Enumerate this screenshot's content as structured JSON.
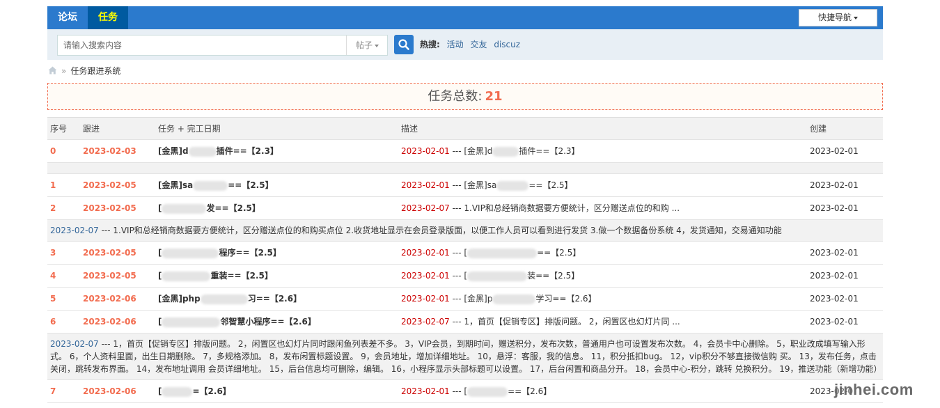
{
  "nav": {
    "forum_label": "论坛",
    "task_label": "任务",
    "quicknav_label": "快捷导航"
  },
  "search": {
    "placeholder": "请输入搜索内容",
    "type_label": "帖子",
    "hot_label": "热搜:",
    "hot_terms": [
      "活动",
      "交友",
      "discuz"
    ]
  },
  "breadcrumb": {
    "current": "任务跟进系统",
    "sep": "»"
  },
  "summary": {
    "label": "任务总数:",
    "count": "21"
  },
  "table": {
    "headers": {
      "idx": "序号",
      "follow": "跟进",
      "task": "任务 + 完工日期",
      "desc": "描述",
      "created": "创建"
    },
    "rows": [
      {
        "idx": "0",
        "follow": "2023-02-03",
        "task_a": "[金黑]d",
        "task_b": "插件==【2.3】",
        "desc_date": "2023-02-01",
        "desc_a": " --- [金黑]d",
        "desc_b": "插件==【2.3】",
        "created": "2023-02-01"
      },
      {
        "idx": "1",
        "follow": "2023-02-05",
        "task_a": "[金黑]sa",
        "task_b": "==【2.5】",
        "desc_date": "2023-02-01",
        "desc_a": " --- [金黑]sa",
        "desc_b": "==【2.5】",
        "created": "2023-02-01"
      },
      {
        "idx": "2",
        "follow": "2023-02-05",
        "task_a": "[",
        "task_b": "发==【2.5】",
        "desc_date": "2023-02-07",
        "desc_a": " --- 1.VIP和总经销商数据要方便统计，区分赠送点位的和购 ...",
        "desc_b": "",
        "created": "2023-02-01"
      },
      {
        "idx": "3",
        "follow": "2023-02-05",
        "task_a": "[",
        "task_b": "程序==【2.5】",
        "desc_date": "2023-02-01",
        "desc_a": " --- [",
        "desc_b": "==【2.5】",
        "created": "2023-02-01"
      },
      {
        "idx": "4",
        "follow": "2023-02-05",
        "task_a": "[",
        "task_b": "重装==【2.5】",
        "desc_date": "2023-02-01",
        "desc_a": " --- [",
        "desc_b": "装==【2.5】",
        "created": "2023-02-01"
      },
      {
        "idx": "5",
        "follow": "2023-02-06",
        "task_a": "[金黑]php",
        "task_b": "习==【2.6】",
        "desc_date": "2023-02-01",
        "desc_a": " --- [金黑]p",
        "desc_b": "学习==【2.6】",
        "created": "2023-02-01"
      },
      {
        "idx": "6",
        "follow": "2023-02-06",
        "task_a": "[",
        "task_b": "邻智慧小程序==【2.6】",
        "desc_date": "2023-02-07",
        "desc_a": " --- 1，首页【促销专区】排版问题。 2，闲置区也幻灯片同 ...",
        "desc_b": "",
        "created": "2023-02-01"
      },
      {
        "idx": "7",
        "follow": "2023-02-06",
        "task_a": "[",
        "task_b": "=【2.6】",
        "desc_date": "2023-02-01",
        "desc_a": " --- [",
        "desc_b": "==【2.6】",
        "created": "2023-02-0"
      }
    ],
    "detail_2": {
      "date": "2023-02-07",
      "text": " --- 1.VIP和总经销商数据要方便统计，区分赠送点位的和购买点位 2.收货地址显示在会员登录版面，以便工作人员可以看到进行发货 3.做一个数据备份系统 4，发货通知，交易通知功能"
    },
    "detail_6": {
      "date": "2023-02-07",
      "text": " --- 1，首页【促销专区】排版问题。 2，闲置区也幻灯片同时跟闲鱼列表差不多。 3，VIP会员，到期时间，赠送积分，发布次数，普通用户也可设置发布次数。 4，会员卡中心删除。 5，职业改成填写输入形式。 6，个人资料里面，出生日期删除。 7，多规格添加。 8，发布闲置标题设置。 9，会员地址，增加详细地址。 10，悬浮：客服，我的信息。 11，积分抵扣bug。 12，vip积分不够直接微信购 买。 13，发布任务，点击 关闭，跳转发布界面。 14，发布地址调用 会员详细地址。 15，后台信息均可删除，编辑。 16，小程序显示头部标题可以设置。 17，后台闲置和商品分开。 18，会员中心-积分，跳转 兑换积分。 19，推送功能（新增功能）"
    }
  },
  "watermark": "jinhei.com",
  "colors": {
    "nav_bg": "#2b7acd",
    "nav_active": "#005aa0",
    "accent": "#f26c4f",
    "desc_date": "#cc0000"
  }
}
